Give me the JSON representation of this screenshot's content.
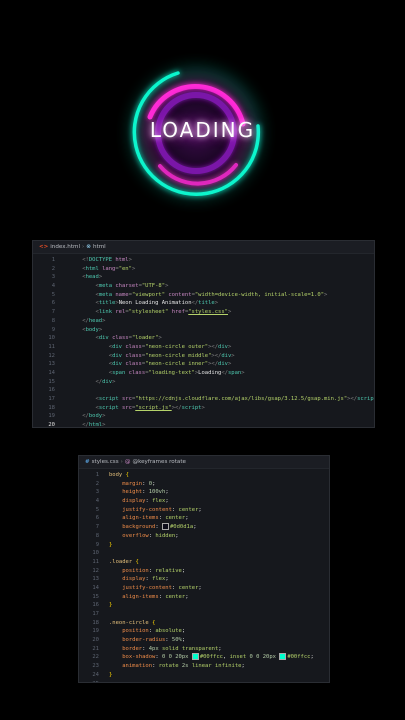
{
  "preview": {
    "loading_text": "LOADING",
    "colors": {
      "magenta": "#ff2bd6",
      "purple": "#7a14a8",
      "cyan": "#00ffcc"
    }
  },
  "html_editor": {
    "breadcrumb": {
      "file": "index.html",
      "element": "html"
    },
    "active_line": 20,
    "lines": [
      {
        "n": 1,
        "indent": 4,
        "tokens": [
          [
            "p",
            "<!"
          ],
          [
            "t",
            "DOCTYPE"
          ],
          [
            "w",
            " "
          ],
          [
            "a",
            "html"
          ],
          [
            "p",
            ">"
          ]
        ]
      },
      {
        "n": 2,
        "indent": 4,
        "tokens": [
          [
            "p",
            "<"
          ],
          [
            "t",
            "html"
          ],
          [
            "w",
            " "
          ],
          [
            "a",
            "lang"
          ],
          [
            "p",
            "="
          ],
          [
            "s",
            "\"en\""
          ],
          [
            "p",
            ">"
          ]
        ]
      },
      {
        "n": 3,
        "indent": 4,
        "tokens": [
          [
            "p",
            "<"
          ],
          [
            "t",
            "head"
          ],
          [
            "p",
            ">"
          ]
        ]
      },
      {
        "n": 4,
        "indent": 8,
        "tokens": [
          [
            "p",
            "<"
          ],
          [
            "t",
            "meta"
          ],
          [
            "w",
            " "
          ],
          [
            "a",
            "charset"
          ],
          [
            "p",
            "="
          ],
          [
            "s",
            "\"UTF-8\""
          ],
          [
            "p",
            ">"
          ]
        ]
      },
      {
        "n": 5,
        "indent": 8,
        "tokens": [
          [
            "p",
            "<"
          ],
          [
            "t",
            "meta"
          ],
          [
            "w",
            " "
          ],
          [
            "a",
            "name"
          ],
          [
            "p",
            "="
          ],
          [
            "s",
            "\"viewport\""
          ],
          [
            "w",
            " "
          ],
          [
            "a",
            "content"
          ],
          [
            "p",
            "="
          ],
          [
            "s",
            "\"width=device-width, initial-scale=1.0\""
          ],
          [
            "p",
            ">"
          ]
        ]
      },
      {
        "n": 6,
        "indent": 8,
        "tokens": [
          [
            "p",
            "<"
          ],
          [
            "t",
            "title"
          ],
          [
            "p",
            ">"
          ],
          [
            "w",
            "Neon Loading Animation"
          ],
          [
            "p",
            "</"
          ],
          [
            "t",
            "title"
          ],
          [
            "p",
            ">"
          ]
        ]
      },
      {
        "n": 7,
        "indent": 8,
        "tokens": [
          [
            "p",
            "<"
          ],
          [
            "t",
            "link"
          ],
          [
            "w",
            " "
          ],
          [
            "a",
            "rel"
          ],
          [
            "p",
            "="
          ],
          [
            "s",
            "\"stylesheet\""
          ],
          [
            "w",
            " "
          ],
          [
            "a",
            "href"
          ],
          [
            "p",
            "="
          ],
          [
            "u",
            "\"styles.css\""
          ],
          [
            "p",
            ">"
          ]
        ]
      },
      {
        "n": 8,
        "indent": 4,
        "tokens": [
          [
            "p",
            "</"
          ],
          [
            "t",
            "head"
          ],
          [
            "p",
            ">"
          ]
        ]
      },
      {
        "n": 9,
        "indent": 4,
        "tokens": [
          [
            "p",
            "<"
          ],
          [
            "t",
            "body"
          ],
          [
            "p",
            ">"
          ]
        ]
      },
      {
        "n": 10,
        "indent": 8,
        "tokens": [
          [
            "p",
            "<"
          ],
          [
            "t",
            "div"
          ],
          [
            "w",
            " "
          ],
          [
            "a",
            "class"
          ],
          [
            "p",
            "="
          ],
          [
            "s",
            "\"loader\""
          ],
          [
            "p",
            ">"
          ]
        ]
      },
      {
        "n": 11,
        "indent": 12,
        "tokens": [
          [
            "p",
            "<"
          ],
          [
            "t",
            "div"
          ],
          [
            "w",
            " "
          ],
          [
            "a",
            "class"
          ],
          [
            "p",
            "="
          ],
          [
            "s",
            "\"neon-circle outer\""
          ],
          [
            "p",
            "></"
          ],
          [
            "t",
            "div"
          ],
          [
            "p",
            ">"
          ]
        ]
      },
      {
        "n": 12,
        "indent": 12,
        "tokens": [
          [
            "p",
            "<"
          ],
          [
            "t",
            "div"
          ],
          [
            "w",
            " "
          ],
          [
            "a",
            "class"
          ],
          [
            "p",
            "="
          ],
          [
            "s",
            "\"neon-circle middle\""
          ],
          [
            "p",
            "></"
          ],
          [
            "t",
            "div"
          ],
          [
            "p",
            ">"
          ]
        ]
      },
      {
        "n": 13,
        "indent": 12,
        "tokens": [
          [
            "p",
            "<"
          ],
          [
            "t",
            "div"
          ],
          [
            "w",
            " "
          ],
          [
            "a",
            "class"
          ],
          [
            "p",
            "="
          ],
          [
            "s",
            "\"neon-circle inner\""
          ],
          [
            "p",
            "></"
          ],
          [
            "t",
            "div"
          ],
          [
            "p",
            ">"
          ]
        ]
      },
      {
        "n": 14,
        "indent": 12,
        "tokens": [
          [
            "p",
            "<"
          ],
          [
            "t",
            "span"
          ],
          [
            "w",
            " "
          ],
          [
            "a",
            "class"
          ],
          [
            "p",
            "="
          ],
          [
            "s",
            "\"loading-text\""
          ],
          [
            "p",
            ">"
          ],
          [
            "w",
            "Loading"
          ],
          [
            "p",
            "</"
          ],
          [
            "t",
            "span"
          ],
          [
            "p",
            ">"
          ]
        ]
      },
      {
        "n": 15,
        "indent": 8,
        "tokens": [
          [
            "p",
            "</"
          ],
          [
            "t",
            "div"
          ],
          [
            "p",
            ">"
          ]
        ]
      },
      {
        "n": 16,
        "indent": 0,
        "tokens": []
      },
      {
        "n": 17,
        "indent": 8,
        "tokens": [
          [
            "p",
            "<"
          ],
          [
            "t",
            "script"
          ],
          [
            "w",
            " "
          ],
          [
            "a",
            "src"
          ],
          [
            "p",
            "="
          ],
          [
            "s",
            "\"https://cdnjs.cloudflare.com/ajax/libs/gsap/3.12.5/gsap.min.js\""
          ],
          [
            "p",
            "></"
          ],
          [
            "t",
            "script"
          ],
          [
            "p",
            ">"
          ]
        ]
      },
      {
        "n": 18,
        "indent": 8,
        "tokens": [
          [
            "p",
            "<"
          ],
          [
            "t",
            "script"
          ],
          [
            "w",
            " "
          ],
          [
            "a",
            "src"
          ],
          [
            "p",
            "="
          ],
          [
            "u",
            "\"script.js\""
          ],
          [
            "p",
            "></"
          ],
          [
            "t",
            "script"
          ],
          [
            "p",
            ">"
          ]
        ]
      },
      {
        "n": 19,
        "indent": 4,
        "tokens": [
          [
            "p",
            "</"
          ],
          [
            "t",
            "body"
          ],
          [
            "p",
            ">"
          ]
        ]
      },
      {
        "n": 20,
        "indent": 4,
        "tokens": [
          [
            "p",
            "</"
          ],
          [
            "t",
            "html"
          ],
          [
            "p",
            ">"
          ]
        ]
      }
    ]
  },
  "css_editor": {
    "breadcrumb": {
      "hash": "#",
      "file": "styles.css",
      "at": "@",
      "rule": "@keyframes rotate"
    },
    "lines": [
      {
        "n": 1,
        "indent": 0,
        "tokens": [
          [
            "sel",
            "body"
          ],
          [
            "w",
            " "
          ],
          [
            "br",
            "{"
          ]
        ]
      },
      {
        "n": 2,
        "indent": 4,
        "tokens": [
          [
            "prp",
            "margin"
          ],
          [
            "w",
            ": "
          ],
          [
            "num",
            "0"
          ],
          [
            "w",
            ";"
          ]
        ]
      },
      {
        "n": 3,
        "indent": 4,
        "tokens": [
          [
            "prp",
            "height"
          ],
          [
            "w",
            ": "
          ],
          [
            "num",
            "100vh"
          ],
          [
            "w",
            ";"
          ]
        ]
      },
      {
        "n": 4,
        "indent": 4,
        "tokens": [
          [
            "prp",
            "display"
          ],
          [
            "w",
            ": "
          ],
          [
            "val",
            "flex"
          ],
          [
            "w",
            ";"
          ]
        ]
      },
      {
        "n": 5,
        "indent": 4,
        "tokens": [
          [
            "prp",
            "justify-content"
          ],
          [
            "w",
            ": "
          ],
          [
            "val",
            "center"
          ],
          [
            "w",
            ";"
          ]
        ]
      },
      {
        "n": 6,
        "indent": 4,
        "tokens": [
          [
            "prp",
            "align-items"
          ],
          [
            "w",
            ": "
          ],
          [
            "val",
            "center"
          ],
          [
            "w",
            ";"
          ]
        ]
      },
      {
        "n": 7,
        "indent": 4,
        "tokens": [
          [
            "prp",
            "background"
          ],
          [
            "w",
            ": "
          ],
          [
            "sw",
            "#0d0d1a"
          ],
          [
            "val",
            "#0d0d1a"
          ],
          [
            "w",
            ";"
          ]
        ]
      },
      {
        "n": 8,
        "indent": 4,
        "tokens": [
          [
            "prp",
            "overflow"
          ],
          [
            "w",
            ": "
          ],
          [
            "val",
            "hidden"
          ],
          [
            "w",
            ";"
          ]
        ]
      },
      {
        "n": 9,
        "indent": 0,
        "tokens": [
          [
            "br",
            "}"
          ]
        ]
      },
      {
        "n": 10,
        "indent": 0,
        "tokens": []
      },
      {
        "n": 11,
        "indent": 0,
        "tokens": [
          [
            "sel",
            ".loader"
          ],
          [
            "w",
            " "
          ],
          [
            "br",
            "{"
          ]
        ]
      },
      {
        "n": 12,
        "indent": 4,
        "tokens": [
          [
            "prp",
            "position"
          ],
          [
            "w",
            ": "
          ],
          [
            "val",
            "relative"
          ],
          [
            "w",
            ";"
          ]
        ]
      },
      {
        "n": 13,
        "indent": 4,
        "tokens": [
          [
            "prp",
            "display"
          ],
          [
            "w",
            ": "
          ],
          [
            "val",
            "flex"
          ],
          [
            "w",
            ";"
          ]
        ]
      },
      {
        "n": 14,
        "indent": 4,
        "tokens": [
          [
            "prp",
            "justify-content"
          ],
          [
            "w",
            ": "
          ],
          [
            "val",
            "center"
          ],
          [
            "w",
            ";"
          ]
        ]
      },
      {
        "n": 15,
        "indent": 4,
        "tokens": [
          [
            "prp",
            "align-items"
          ],
          [
            "w",
            ": "
          ],
          [
            "val",
            "center"
          ],
          [
            "w",
            ";"
          ]
        ]
      },
      {
        "n": 16,
        "indent": 0,
        "tokens": [
          [
            "br",
            "}"
          ]
        ]
      },
      {
        "n": 17,
        "indent": 0,
        "tokens": []
      },
      {
        "n": 18,
        "indent": 0,
        "tokens": [
          [
            "sel",
            ".neon-circle"
          ],
          [
            "w",
            " "
          ],
          [
            "br",
            "{"
          ]
        ]
      },
      {
        "n": 19,
        "indent": 4,
        "tokens": [
          [
            "prp",
            "position"
          ],
          [
            "w",
            ": "
          ],
          [
            "val",
            "absolute"
          ],
          [
            "w",
            ";"
          ]
        ]
      },
      {
        "n": 20,
        "indent": 4,
        "tokens": [
          [
            "prp",
            "border-radius"
          ],
          [
            "w",
            ": "
          ],
          [
            "num",
            "50%"
          ],
          [
            "w",
            ";"
          ]
        ]
      },
      {
        "n": 21,
        "indent": 4,
        "tokens": [
          [
            "prp",
            "border"
          ],
          [
            "w",
            ": "
          ],
          [
            "num",
            "4px"
          ],
          [
            "w",
            " "
          ],
          [
            "val",
            "solid transparent"
          ],
          [
            "w",
            ";"
          ]
        ]
      },
      {
        "n": 22,
        "indent": 4,
        "tokens": [
          [
            "prp",
            "box-shadow"
          ],
          [
            "w",
            ": "
          ],
          [
            "num",
            "0 0 20px"
          ],
          [
            "w",
            " "
          ],
          [
            "sw",
            "#00ffcc"
          ],
          [
            "val",
            "#00ffcc"
          ],
          [
            "w",
            ", "
          ],
          [
            "val",
            "inset"
          ],
          [
            "w",
            " "
          ],
          [
            "num",
            "0 0 20px"
          ],
          [
            "w",
            " "
          ],
          [
            "sw",
            "#00ffcc"
          ],
          [
            "val",
            "#00ffcc"
          ],
          [
            "w",
            ";"
          ]
        ]
      },
      {
        "n": 23,
        "indent": 4,
        "tokens": [
          [
            "prp",
            "animation"
          ],
          [
            "w",
            ": "
          ],
          [
            "val",
            "rotate"
          ],
          [
            "w",
            " "
          ],
          [
            "num",
            "2s"
          ],
          [
            "w",
            " "
          ],
          [
            "val",
            "linear infinite"
          ],
          [
            "w",
            ";"
          ]
        ]
      },
      {
        "n": 24,
        "indent": 0,
        "tokens": [
          [
            "br",
            "}"
          ]
        ]
      },
      {
        "n": 25,
        "indent": 0,
        "tokens": []
      }
    ]
  }
}
